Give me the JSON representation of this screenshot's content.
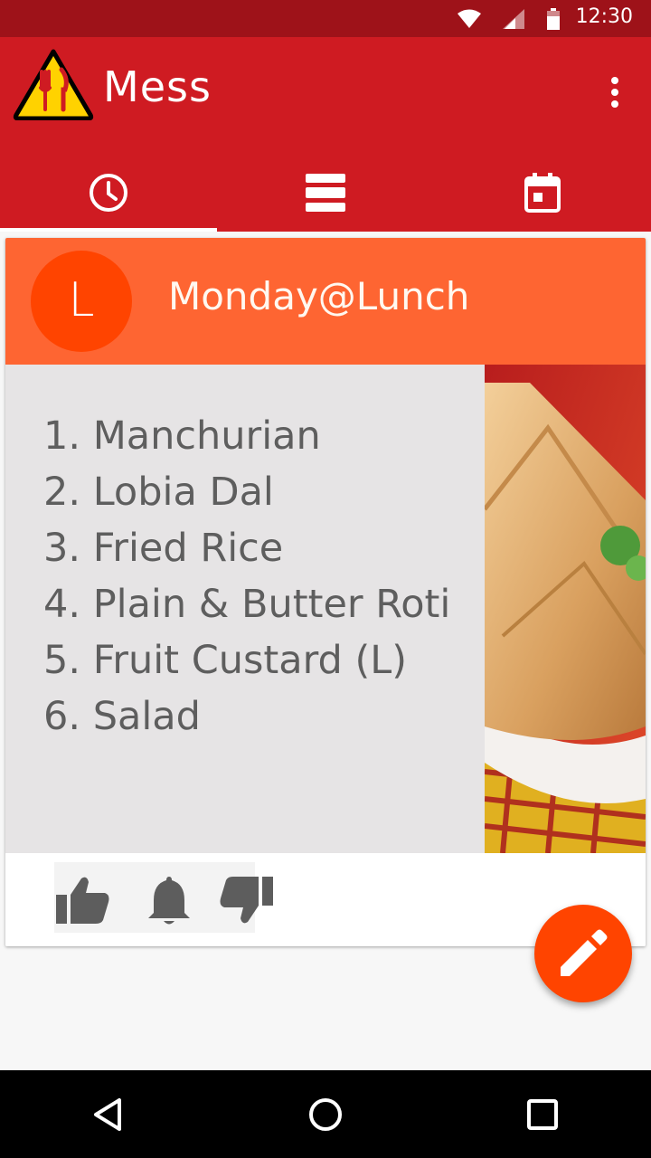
{
  "status_bar": {
    "time": "12:30",
    "icons": [
      "wifi-icon",
      "signal-icon",
      "battery-icon"
    ]
  },
  "app_bar": {
    "title": "Mess",
    "logo_icon": "warning-fork-knife-logo",
    "overflow_icon": "more-vert-icon"
  },
  "tabs": [
    {
      "icon": "clock-icon",
      "active": true
    },
    {
      "icon": "view-list-icon",
      "active": false
    },
    {
      "icon": "calendar-icon",
      "active": false
    }
  ],
  "meal_card": {
    "avatar_letter": "L",
    "title": "Monday@Lunch",
    "items": [
      "1. Manchurian",
      "2. Lobia Dal",
      "3. Fried Rice",
      "4. Plain & Butter Roti",
      "5. Fruit Custard (L)",
      "6. Salad"
    ],
    "actions": [
      "thumb-up-icon",
      "bell-icon",
      "thumb-down-icon"
    ]
  },
  "fab": {
    "icon": "pencil-edit-icon"
  },
  "nav_bar": {
    "icons": [
      "back-icon",
      "home-icon",
      "recents-icon"
    ]
  },
  "colors": {
    "status_bar": "#9e1219",
    "app_bar": "#cf1b22",
    "card_header": "#fe6532",
    "avatar": "#ff4400",
    "fab": "#ff4400",
    "menu_bg": "#e6e4e5",
    "menu_text": "#5e5e5e"
  }
}
